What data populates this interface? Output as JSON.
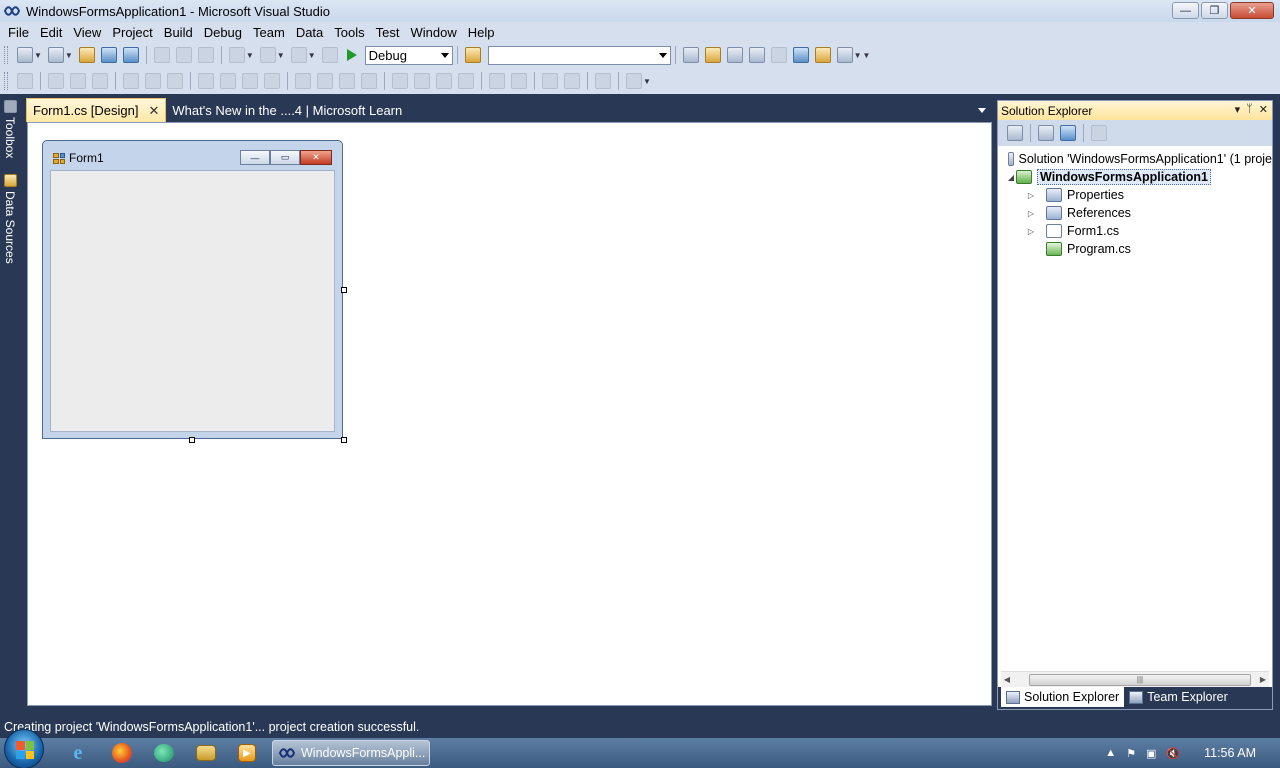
{
  "window": {
    "title": "WindowsFormsApplication1 - Microsoft Visual Studio",
    "minimize": "—",
    "maximize": "❐",
    "close": "✕"
  },
  "menu": [
    "File",
    "Edit",
    "View",
    "Project",
    "Build",
    "Debug",
    "Team",
    "Data",
    "Tools",
    "Test",
    "Window",
    "Help"
  ],
  "toolbar": {
    "configuration": "Debug",
    "platform": ""
  },
  "side_tabs": {
    "toolbox": "Toolbox",
    "data_sources": "Data Sources"
  },
  "doc_tabs": [
    {
      "label": "Form1.cs [Design]",
      "close": "✕"
    },
    {
      "label": "What's New in the ....4 | Microsoft Learn"
    }
  ],
  "form": {
    "title": "Form1",
    "min": "—",
    "max": "▭",
    "close": "✕"
  },
  "solution_explorer": {
    "title": "Solution Explorer",
    "header_buttons": {
      "menu": "▾",
      "pin": "ᛘ",
      "close": "✕"
    },
    "tree": {
      "solution": "Solution 'WindowsFormsApplication1' (1 proje",
      "project": "WindowsFormsApplication1",
      "items": [
        "Properties",
        "References",
        "Form1.cs",
        "Program.cs"
      ]
    },
    "bottom_tabs": [
      "Solution Explorer",
      "Team Explorer"
    ]
  },
  "status": "Creating project 'WindowsFormsApplication1'... project creation successful.",
  "taskbar": {
    "active_task": "WindowsFormsAppli...",
    "clock": "11:56 AM"
  },
  "colors": {
    "ide_background": "#293955",
    "tab_active": "#ffe8a6",
    "chrome": "#d6dfee"
  }
}
